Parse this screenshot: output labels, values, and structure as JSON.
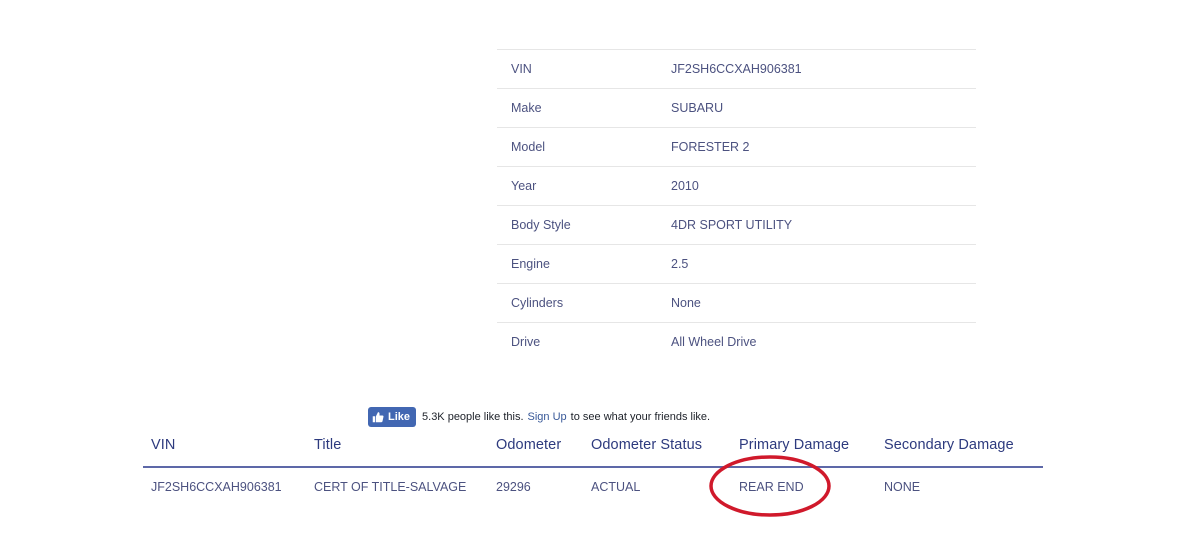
{
  "specs": {
    "rows": [
      {
        "label": "VIN",
        "value": "JF2SH6CCXAH906381"
      },
      {
        "label": "Make",
        "value": "SUBARU"
      },
      {
        "label": "Model",
        "value": "FORESTER 2"
      },
      {
        "label": "Year",
        "value": "2010"
      },
      {
        "label": "Body Style",
        "value": "4DR SPORT UTILITY"
      },
      {
        "label": "Engine",
        "value": "2.5"
      },
      {
        "label": "Cylinders",
        "value": "None"
      },
      {
        "label": "Drive",
        "value": "All Wheel Drive"
      }
    ]
  },
  "facebook": {
    "like_label": "Like",
    "count_text": "5.3K people like this.",
    "signup_link": "Sign Up",
    "suffix_text": "to see what your friends like.",
    "brand_color": "#4267b2"
  },
  "lot": {
    "headers": [
      "VIN",
      "Title",
      "Odometer",
      "Odometer Status",
      "Primary Damage",
      "Secondary Damage"
    ],
    "row": {
      "vin": "JF2SH6CCXAH906381",
      "title": "CERT OF TITLE-SALVAGE",
      "odometer": "29296",
      "odometer_status": "ACTUAL",
      "primary_damage": "REAR END",
      "secondary_damage": "NONE"
    },
    "header_color": "#2d3a7e",
    "divider_color": "#5d68a8"
  },
  "annotation": {
    "shape": "ellipse",
    "color": "#d0192b",
    "highlights": "primary_damage"
  }
}
